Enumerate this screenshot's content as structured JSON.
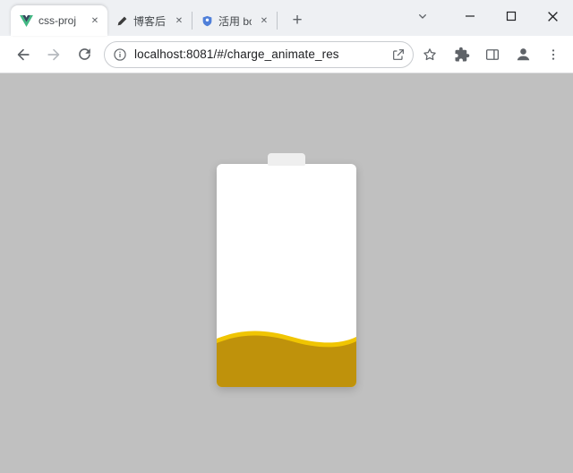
{
  "theme": {
    "page-bg": "#c0c0c0",
    "battery-bg": "#ffffff",
    "cap-bg": "#efefef",
    "wave-dark": "#bf920b",
    "wave-bright": "#f0c502"
  },
  "tabs": {
    "items": [
      {
        "label": "css-proj",
        "active": true
      },
      {
        "label": "博客后台",
        "active": false
      },
      {
        "label": "活用 bor",
        "active": false
      }
    ],
    "close_glyph": "✕",
    "new_tab_glyph": "+"
  },
  "toolbar": {
    "url": "localhost:8081/#/charge_animate_res"
  },
  "content": {
    "battery_level_percent": 26
  },
  "icons": {
    "tab1_favicon": "vue-logo",
    "tab2_favicon": "dark-pen-logo",
    "tab3_favicon": "blue-shield-logo",
    "toolbar": [
      "back-arrow",
      "forward-arrow",
      "reload",
      "info-circle",
      "share",
      "star-outline",
      "extensions-puzzle",
      "side-panel",
      "profile-avatar",
      "menu-dots"
    ],
    "window": [
      "chevron-down",
      "minimize",
      "maximize",
      "close"
    ]
  }
}
